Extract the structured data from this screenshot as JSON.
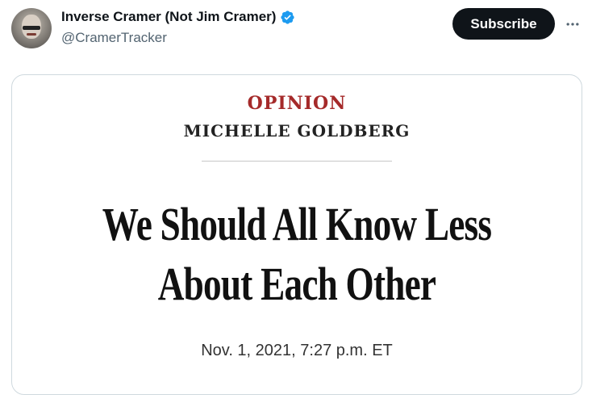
{
  "tweet": {
    "display_name": "Inverse Cramer (Not Jim Cramer)",
    "handle": "@CramerTracker",
    "verified_icon": "verified-badge-icon",
    "subscribe_label": "Subscribe",
    "more_icon": "more-options-icon"
  },
  "card": {
    "section": "OPINION",
    "author": "MICHELLE GOLDBERG",
    "headline_line1": "We Should All Know Less",
    "headline_line2": "About Each Other",
    "date": "Nov. 1, 2021, 7:27 p.m. ET"
  },
  "colors": {
    "accent_blue": "#1d9bf0",
    "section_red": "#a52a2a",
    "button_bg": "#0f1419"
  }
}
